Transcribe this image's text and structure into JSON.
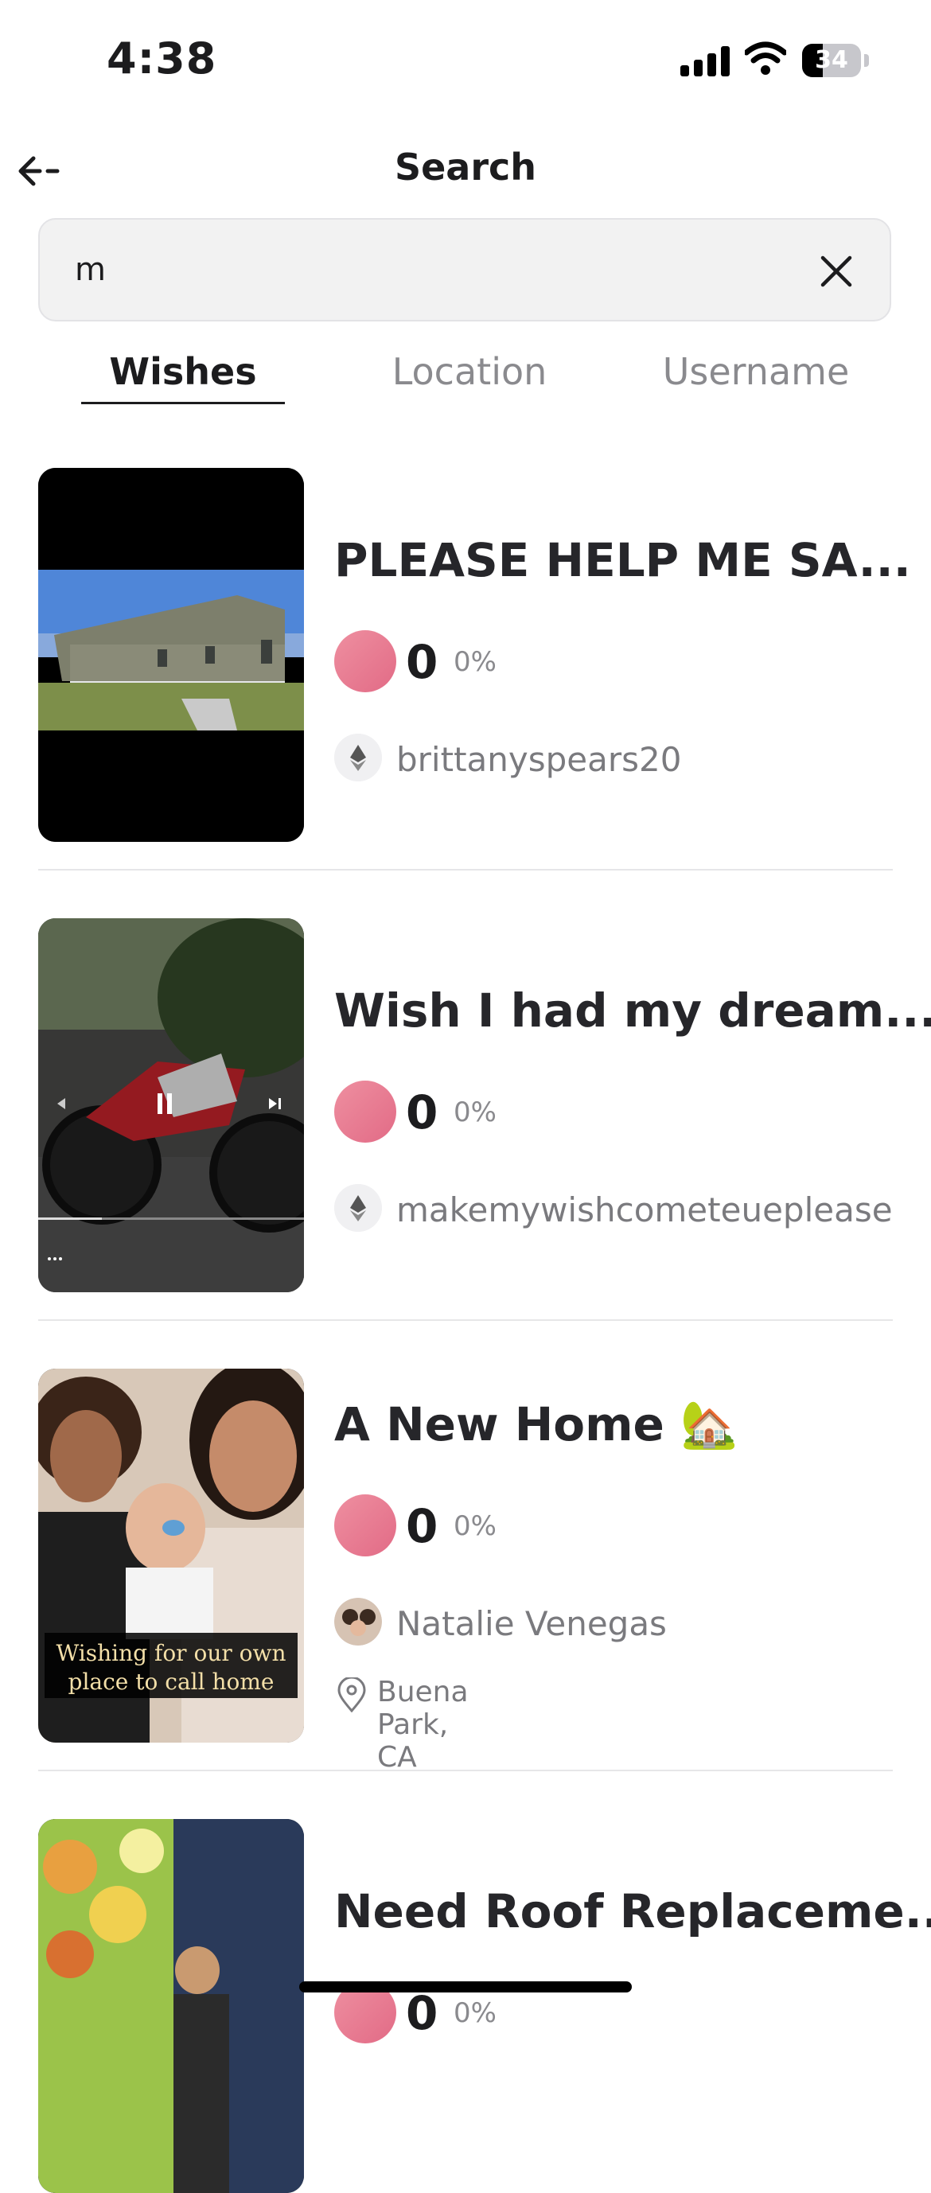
{
  "status_bar": {
    "time": "4:38",
    "battery": "34"
  },
  "header": {
    "title": "Search"
  },
  "search": {
    "value": "m"
  },
  "tabs": [
    {
      "label": "Wishes",
      "active": true
    },
    {
      "label": "Location",
      "active": false
    },
    {
      "label": "Username",
      "active": false
    }
  ],
  "results": [
    {
      "title": "PLEASE HELP ME SA...",
      "amount": "0",
      "percent": "0%",
      "username": "brittanyspears20",
      "location": ""
    },
    {
      "title": "Wish I had my dream...",
      "amount": "0",
      "percent": "0%",
      "username": "makemywishcometeueplease",
      "location": ""
    },
    {
      "title": "A New Home 🏡",
      "amount": "0",
      "percent": "0%",
      "username": "Natalie Venegas",
      "location": "Buena Park, CA",
      "thumb_caption": "Wishing for our own place to call  home"
    },
    {
      "title": "Need Roof Replaceme...",
      "amount": "0",
      "percent": "0%",
      "username": "",
      "location": ""
    }
  ],
  "colors": {
    "accent_coin": "#e26b86",
    "text_secondary": "#8a8a8e"
  }
}
